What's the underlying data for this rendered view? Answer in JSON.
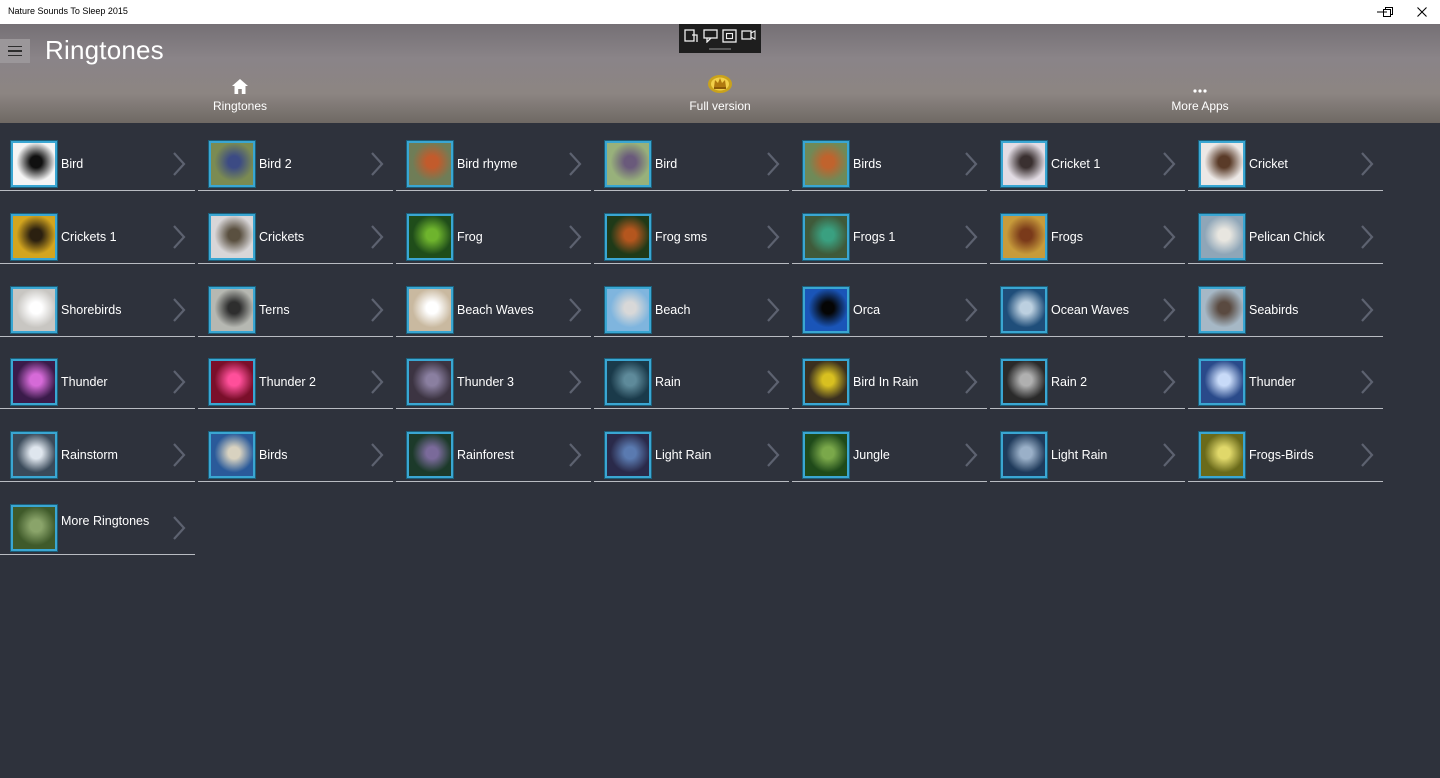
{
  "window": {
    "title": "Nature Sounds To Sleep 2015",
    "controls": [
      "minimize-icon",
      "restore-icon",
      "close-icon"
    ]
  },
  "header": {
    "page_title": "Ringtones",
    "menu_icon": "hamburger-icon",
    "nav": [
      {
        "label": "Ringtones",
        "icon": "home-icon"
      },
      {
        "label": "Full version",
        "icon": "crown-icon"
      },
      {
        "label": "More Apps",
        "icon": "more-icon"
      }
    ]
  },
  "floating_toolbar": {
    "icons": [
      "screenshot-icon",
      "comment-icon",
      "fullscreen-icon",
      "record-icon"
    ]
  },
  "colors": {
    "background": "#2e323c",
    "accent_border": "#3aa6d2",
    "divider": "#b9bcc2"
  },
  "items": [
    {
      "label": "Bird",
      "thumb": [
        "#f4f4f4",
        "#101010"
      ]
    },
    {
      "label": "Bird 2",
      "thumb": [
        "#7b8b52",
        "#3c4b84"
      ]
    },
    {
      "label": "Bird rhyme",
      "thumb": [
        "#6f7d57",
        "#c25b2c"
      ]
    },
    {
      "label": "Bird",
      "thumb": [
        "#98b17b",
        "#6a5a7b"
      ]
    },
    {
      "label": "Birds",
      "thumb": [
        "#6f8a58",
        "#c0632d"
      ]
    },
    {
      "label": "Cricket 1",
      "thumb": [
        "#e2dce4",
        "#3a3030"
      ]
    },
    {
      "label": "Cricket",
      "thumb": [
        "#ece8e6",
        "#5a3b28"
      ]
    },
    {
      "label": "Crickets 1",
      "thumb": [
        "#d3a51f",
        "#2b2010"
      ]
    },
    {
      "label": "Crickets",
      "thumb": [
        "#d8d6d8",
        "#5a5040"
      ]
    },
    {
      "label": "Frog",
      "thumb": [
        "#1f4d1a",
        "#6eb42d"
      ]
    },
    {
      "label": "Frog sms",
      "thumb": [
        "#1f3a18",
        "#b4561e"
      ]
    },
    {
      "label": "Frogs 1",
      "thumb": [
        "#3f5a3a",
        "#3aa080"
      ]
    },
    {
      "label": "Frogs",
      "thumb": [
        "#c79b3b",
        "#7a3a1a"
      ]
    },
    {
      "label": "Pelican Chick",
      "thumb": [
        "#8fa6b8",
        "#e8e6e0"
      ]
    },
    {
      "label": "Shorebirds",
      "thumb": [
        "#c8c6c2",
        "#ffffff"
      ]
    },
    {
      "label": "Terns",
      "thumb": [
        "#b6b8b2",
        "#2e2e2e"
      ]
    },
    {
      "label": "Beach Waves",
      "thumb": [
        "#c9b9a0",
        "#ffffff"
      ]
    },
    {
      "label": "Beach",
      "thumb": [
        "#7fb5de",
        "#d8d8d8"
      ]
    },
    {
      "label": "Orca",
      "thumb": [
        "#1a55b8",
        "#050505"
      ]
    },
    {
      "label": "Ocean Waves",
      "thumb": [
        "#1f4e7a",
        "#bcd0e0"
      ]
    },
    {
      "label": "Seabirds",
      "thumb": [
        "#a6b8c6",
        "#5a4a40"
      ]
    },
    {
      "label": "Thunder",
      "thumb": [
        "#3a1b4a",
        "#d66ad8"
      ]
    },
    {
      "label": "Thunder 2",
      "thumb": [
        "#7a0f2a",
        "#ff4f9a"
      ]
    },
    {
      "label": "Thunder 3",
      "thumb": [
        "#3c3442",
        "#8a7fa0"
      ]
    },
    {
      "label": "Rain",
      "thumb": [
        "#1a3a4a",
        "#5e8a9a"
      ]
    },
    {
      "label": "Bird In Rain",
      "thumb": [
        "#3a3020",
        "#d8c020"
      ]
    },
    {
      "label": "Rain 2",
      "thumb": [
        "#2a2a2a",
        "#b0b0b0"
      ]
    },
    {
      "label": "Thunder",
      "thumb": [
        "#2a4a8a",
        "#c8daf8"
      ]
    },
    {
      "label": "Rainstorm",
      "thumb": [
        "#3a4a5a",
        "#dfe6ee"
      ]
    },
    {
      "label": "Birds",
      "thumb": [
        "#2a5a9a",
        "#d8d2c0"
      ]
    },
    {
      "label": "Rainforest",
      "thumb": [
        "#1c3a2a",
        "#7a6a9a"
      ]
    },
    {
      "label": "Light Rain",
      "thumb": [
        "#2a2a4a",
        "#5a7ab0"
      ]
    },
    {
      "label": "Jungle",
      "thumb": [
        "#1f4a1a",
        "#7aa84a"
      ]
    },
    {
      "label": "Light Rain",
      "thumb": [
        "#1f3a5a",
        "#9ab0c8"
      ]
    },
    {
      "label": "Frogs-Birds",
      "thumb": [
        "#6a6a1a",
        "#e0d86a"
      ]
    },
    {
      "label": "More Ringtones",
      "thumb": [
        "#3f5a2a",
        "#8aa46a"
      ]
    }
  ]
}
